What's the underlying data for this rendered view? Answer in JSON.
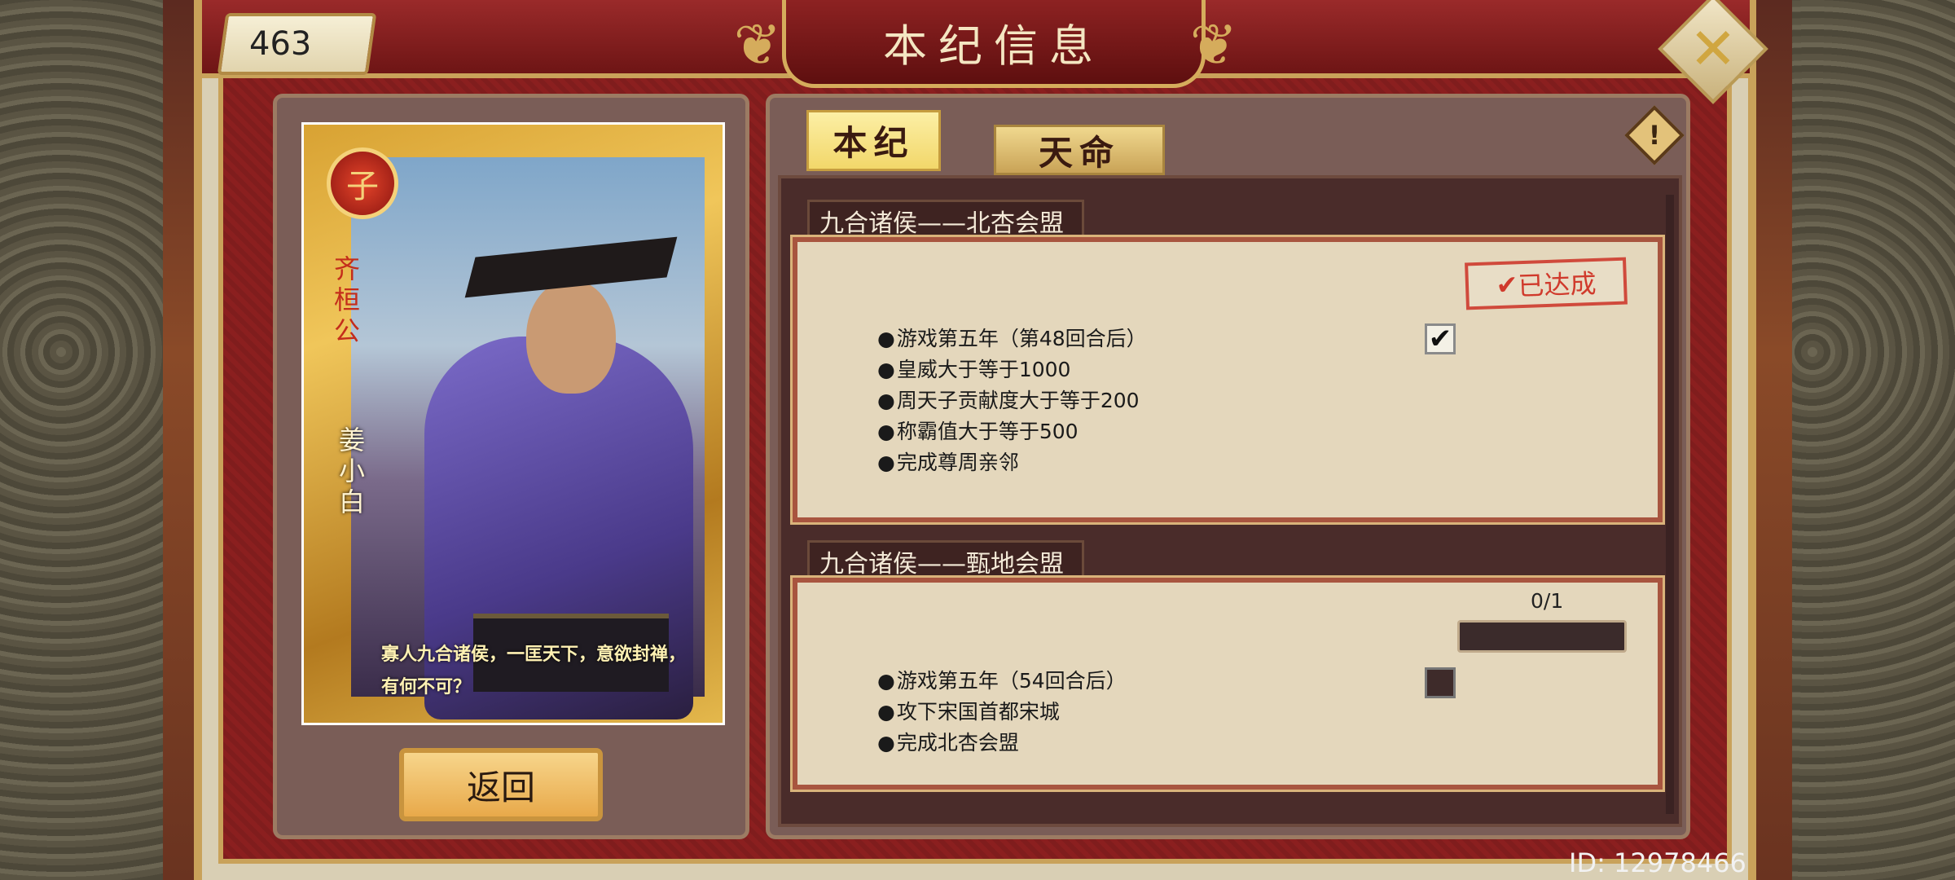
{
  "header": {
    "title": "本纪信息",
    "counter_value": "463",
    "close_icon": "close-icon"
  },
  "card": {
    "badge_char": "子",
    "title_vertical": "齐桓公",
    "name_vertical": "姜小白",
    "quote": "寡人九合诸侯，一匡天下，意欲封禅，有何不可？"
  },
  "buttons": {
    "return_label": "返回"
  },
  "tabs": [
    {
      "label": "本纪",
      "active": true
    },
    {
      "label": "天命",
      "active": false
    }
  ],
  "info_icon": "!",
  "quests": [
    {
      "title": "九合诸侯——北杏会盟",
      "status": "已达成",
      "conditions": [
        "游戏第五年（第48回合后）",
        "皇威大于等于1000",
        "周天子贡献度大于等于200",
        "称霸值大于等于500",
        "完成尊周亲邻"
      ],
      "checked": true
    },
    {
      "title": "九合诸侯——甄地会盟",
      "progress_text": "0/1",
      "progress_fraction": 0,
      "conditions": [
        "游戏第五年（54回合后）",
        "攻下宋国首都宋城",
        "完成北杏会盟"
      ],
      "checked": false
    }
  ],
  "footer": {
    "id_text": "ID: 12978466"
  },
  "colors": {
    "frame_red": "#8b1f1f",
    "gold": "#c9a25a",
    "parchment": "#e4d7bc",
    "stamp_red": "#d03a2c"
  }
}
